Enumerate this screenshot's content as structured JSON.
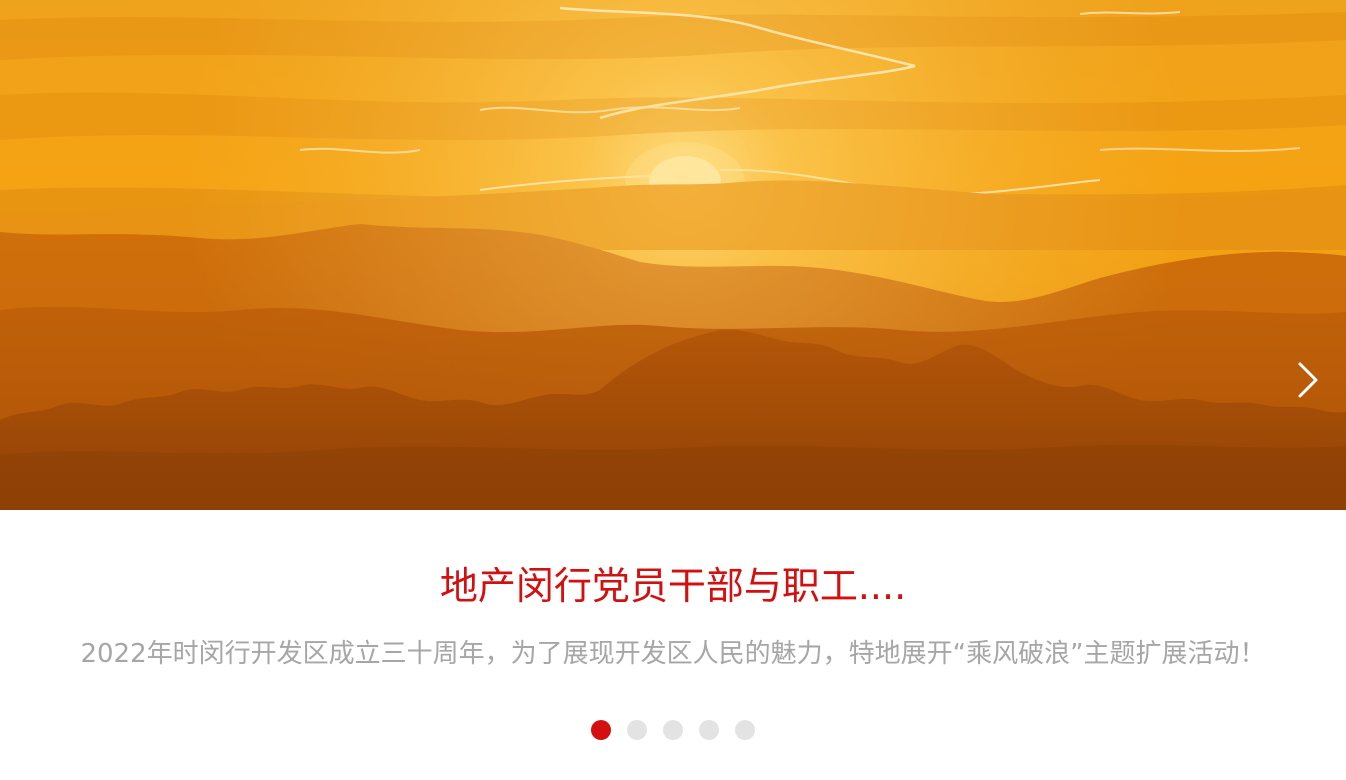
{
  "slider": {
    "image": {
      "alt": "",
      "colors": {
        "sky_top": "#f0a01a",
        "sky_mid": "#f6a010",
        "horizon": "#f7c24b",
        "sun": "#fff4c6",
        "mountains_far": "#c9670a",
        "mountains_near": "#b85907",
        "trees": "#9c4606"
      }
    },
    "next_icon": "chevron-right-icon",
    "title": "地产闵行党员干部与职工....",
    "description": "2022年时闵行开发区成立三十周年，为了展现开发区人民的魅力，特地展开“乘风破浪”主题扩展活动！",
    "dots": {
      "total": 5,
      "active_index": 0,
      "active_color": "#d40f0f",
      "inactive_color": "#e3e3e3"
    }
  }
}
